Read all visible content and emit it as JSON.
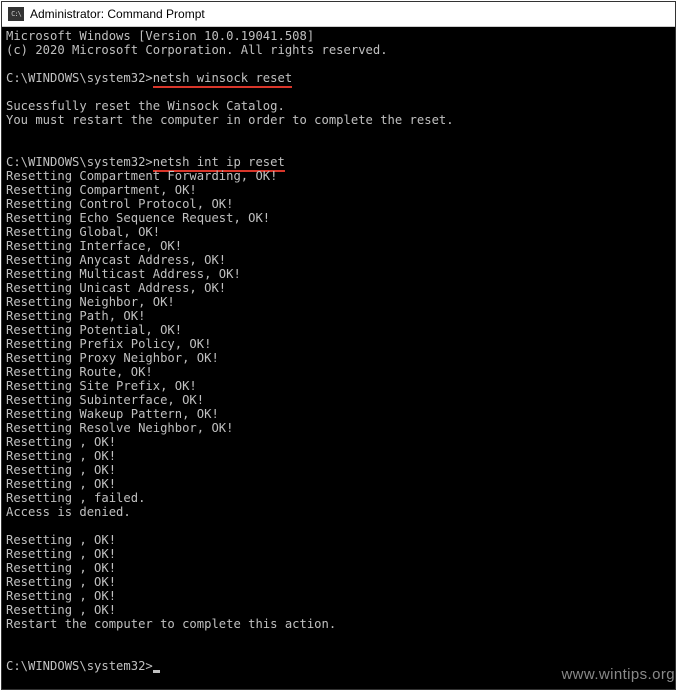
{
  "window": {
    "title": "Administrator: Command Prompt"
  },
  "term": {
    "l1": "Microsoft Windows [Version 10.0.19041.508]",
    "l2": "(c) 2020 Microsoft Corporation. All rights reserved.",
    "prompt1_path": "C:\\WINDOWS\\system32>",
    "cmd1": "netsh winsock reset",
    "out1a": "Sucessfully reset the Winsock Catalog.",
    "out1b": "You must restart the computer in order to complete the reset.",
    "prompt2_path": "C:\\WINDOWS\\system32>",
    "cmd2": "netsh int ip reset",
    "r01": "Resetting Compartment Forwarding, OK!",
    "r02": "Resetting Compartment, OK!",
    "r03": "Resetting Control Protocol, OK!",
    "r04": "Resetting Echo Sequence Request, OK!",
    "r05": "Resetting Global, OK!",
    "r06": "Resetting Interface, OK!",
    "r07": "Resetting Anycast Address, OK!",
    "r08": "Resetting Multicast Address, OK!",
    "r09": "Resetting Unicast Address, OK!",
    "r10": "Resetting Neighbor, OK!",
    "r11": "Resetting Path, OK!",
    "r12": "Resetting Potential, OK!",
    "r13": "Resetting Prefix Policy, OK!",
    "r14": "Resetting Proxy Neighbor, OK!",
    "r15": "Resetting Route, OK!",
    "r16": "Resetting Site Prefix, OK!",
    "r17": "Resetting Subinterface, OK!",
    "r18": "Resetting Wakeup Pattern, OK!",
    "r19": "Resetting Resolve Neighbor, OK!",
    "r20": "Resetting , OK!",
    "r21": "Resetting , OK!",
    "r22": "Resetting , OK!",
    "r23": "Resetting , OK!",
    "r24": "Resetting , failed.",
    "r25": "Access is denied.",
    "r26": "Resetting , OK!",
    "r27": "Resetting , OK!",
    "r28": "Resetting , OK!",
    "r29": "Resetting , OK!",
    "r30": "Resetting , OK!",
    "r31": "Resetting , OK!",
    "r32": "Restart the computer to complete this action.",
    "prompt3_path": "C:\\WINDOWS\\system32>"
  },
  "watermark": "www.wintips.org"
}
